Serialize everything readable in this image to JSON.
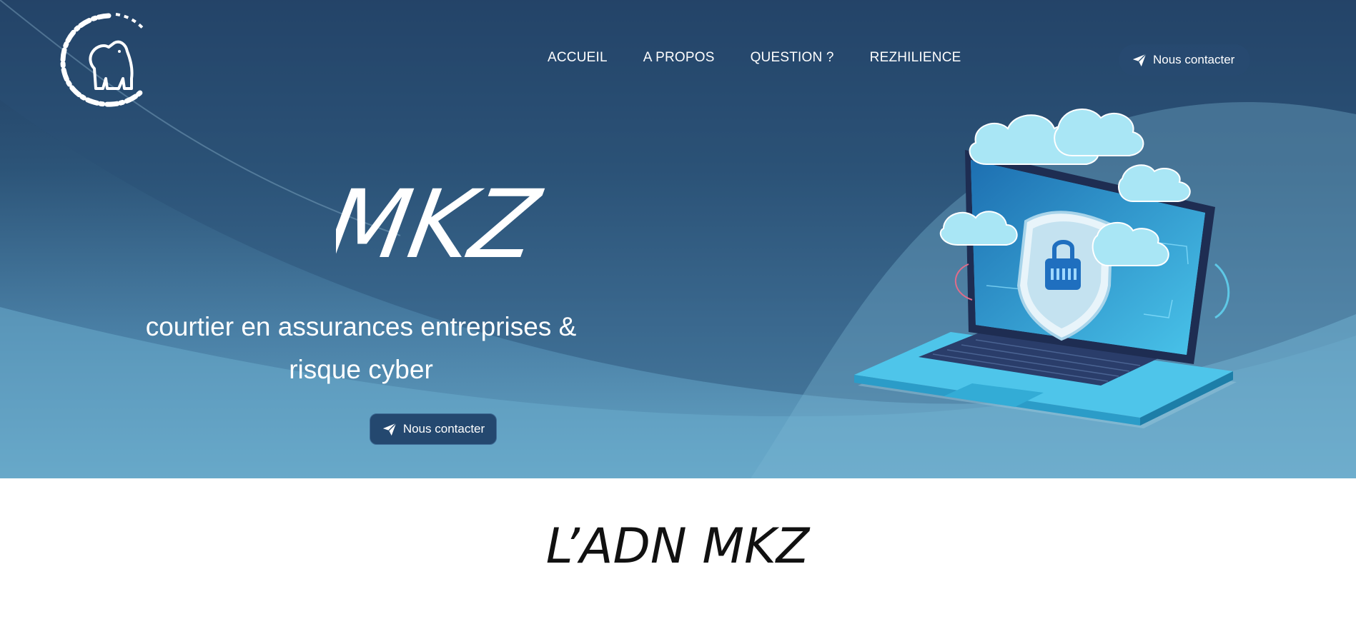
{
  "header": {
    "logo": {
      "icon": "gorilla-icon"
    },
    "nav": [
      {
        "label": "ACCUEIL"
      },
      {
        "label": "A PROPOS"
      },
      {
        "label": "QUESTION ?"
      },
      {
        "label": "REZHILIENCE"
      }
    ],
    "cta": {
      "label": "Nous contacter",
      "icon": "paper-plane-icon"
    }
  },
  "hero": {
    "title": "MKZ",
    "subtitle": "courtier en assurances entreprises & risque cyber",
    "cta": {
      "label": "Nous contacter",
      "icon": "paper-plane-icon"
    },
    "illustration": "laptop-cloud-shield-lock-illustration"
  },
  "section": {
    "title": "L’ADN MKZ"
  },
  "colors": {
    "hero_top": "#1f3a5e",
    "hero_bottom": "#66a6c6",
    "button_bg": "#24486f",
    "text_light": "#ffffff",
    "text_dark": "#111111"
  }
}
